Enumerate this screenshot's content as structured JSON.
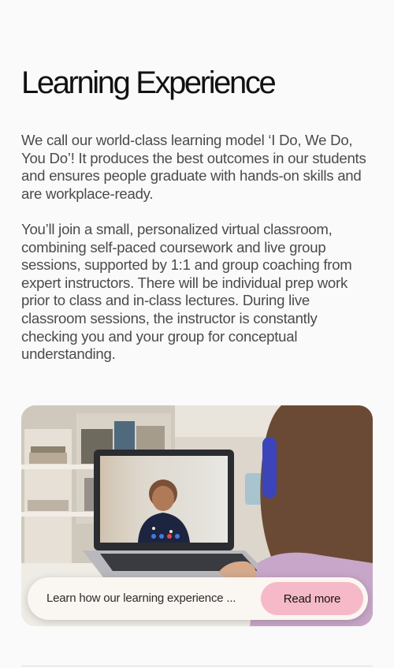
{
  "section": {
    "title": "Learning Experience",
    "paragraph_1": "We call our world-class learning model ‘I Do, We Do, You Do’! It produces the best outcomes in our students and ensures people graduate with hands-on skills and are workplace-ready.",
    "paragraph_2": "You’ll join a small, personalized virtual classroom, combining self-paced coursework and live group sessions, supported by 1:1 and group coaching from expert instructors. There will be individual prep work prior to class and in-class lectures. During live classroom sessions, the instructor is constantly checking you and your group for conceptual understanding."
  },
  "media_card": {
    "image_icon": "video-call-photo",
    "cta_text": "Learn how our learning experience ...",
    "read_more_label": "Read more",
    "button_color": "#f6b9c7"
  }
}
